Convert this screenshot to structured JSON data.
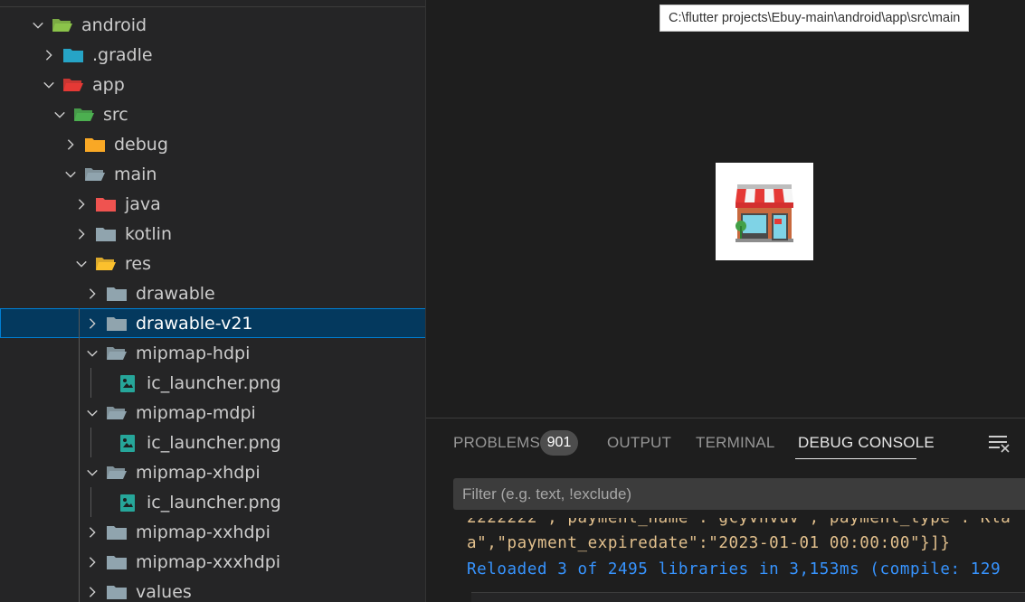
{
  "explorer": {
    "items": [
      {
        "label": "android",
        "expanded": true,
        "icon": "android-folder-icon",
        "color": "#8bc34a"
      },
      {
        "label": ".gradle",
        "expanded": false,
        "icon": "gradle-folder-icon",
        "color": "#26a4c6"
      },
      {
        "label": "app",
        "expanded": true,
        "icon": "app-folder-icon",
        "color": "#e53935"
      },
      {
        "label": "src",
        "expanded": true,
        "icon": "src-folder-icon",
        "color": "#4caf50"
      },
      {
        "label": "debug",
        "expanded": false,
        "icon": "debug-folder-icon",
        "color": "#f9a825"
      },
      {
        "label": "main",
        "expanded": true,
        "icon": "folder-open-icon",
        "color": "#90a4ae"
      },
      {
        "label": "java",
        "expanded": false,
        "icon": "java-folder-icon",
        "color": "#ef5350"
      },
      {
        "label": "kotlin",
        "expanded": false,
        "icon": "folder-icon",
        "color": "#90a4ae"
      },
      {
        "label": "res",
        "expanded": true,
        "icon": "res-folder-icon",
        "color": "#fbc02d"
      },
      {
        "label": "drawable",
        "expanded": false,
        "icon": "folder-icon",
        "color": "#90a4ae"
      },
      {
        "label": "drawable-v21",
        "expanded": false,
        "icon": "folder-icon",
        "color": "#90a4ae",
        "selected": true
      },
      {
        "label": "mipmap-hdpi",
        "expanded": true,
        "icon": "folder-open-icon",
        "color": "#90a4ae"
      },
      {
        "label": "ic_launcher.png",
        "icon": "image-file-icon",
        "color": "#26a69a"
      },
      {
        "label": "mipmap-mdpi",
        "expanded": true,
        "icon": "folder-open-icon",
        "color": "#90a4ae"
      },
      {
        "label": "ic_launcher.png",
        "icon": "image-file-icon",
        "color": "#26a69a"
      },
      {
        "label": "mipmap-xhdpi",
        "expanded": true,
        "icon": "folder-open-icon",
        "color": "#90a4ae"
      },
      {
        "label": "ic_launcher.png",
        "icon": "image-file-icon",
        "color": "#26a69a"
      },
      {
        "label": "mipmap-xxhdpi",
        "expanded": false,
        "icon": "folder-icon",
        "color": "#90a4ae"
      },
      {
        "label": "mipmap-xxxhdpi",
        "expanded": false,
        "icon": "folder-icon",
        "color": "#90a4ae"
      },
      {
        "label": "values",
        "expanded": false,
        "icon": "folder-icon",
        "color": "#90a4ae"
      }
    ]
  },
  "editor": {
    "tooltip": "C:\\flutter projects\\Ebuy-main\\android\\app\\src\\main",
    "preview_icon": "store-icon"
  },
  "panel": {
    "tabs": {
      "problems": "PROBLEMS",
      "problems_count": "901",
      "output": "OUTPUT",
      "terminal": "TERMINAL",
      "debug_console": "DEBUG CONSOLE"
    },
    "filter_placeholder": "Filter (e.g. text, !exclude)",
    "console_lines": [
      "2222222\",\"payment_name\":\"gcyvhvuv\",\"payment_type\":\"Kla",
      "a\",\"payment_expiredate\":\"2023-01-01 00:00:00\"}]}",
      "Reloaded 3 of 2495 libraries in 3,153ms (compile: 129"
    ]
  },
  "colors": {
    "selection_bg": "#04395e",
    "selection_border": "#007fd4",
    "console_text": "#e2c08d",
    "console_info": "#3794ff"
  }
}
